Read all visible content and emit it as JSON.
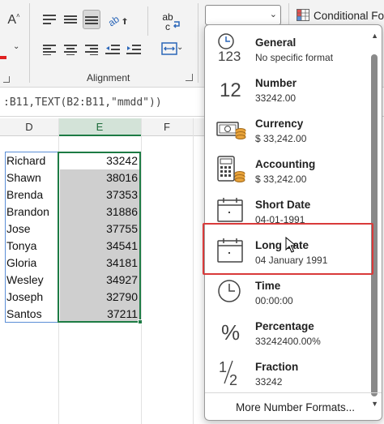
{
  "ribbon": {
    "alignment_group_label": "Alignment",
    "font_size_increase_label": "A",
    "wrap_label": "ab",
    "wrap_label_2": "c",
    "number_format_value": "",
    "conditional_formatting_label": "Conditional For"
  },
  "formula_bar": {
    "text": ":B11,TEXT(B2:B11,\"mmdd\"))"
  },
  "columns": [
    "D",
    "E",
    "F"
  ],
  "rows": [
    {
      "name": "Richard",
      "value": "33242"
    },
    {
      "name": "Shawn",
      "value": "38016"
    },
    {
      "name": "Brenda",
      "value": "37353"
    },
    {
      "name": "Brandon",
      "value": "31886"
    },
    {
      "name": "Jose",
      "value": "37755"
    },
    {
      "name": "Tonya",
      "value": "34541"
    },
    {
      "name": "Gloria",
      "value": "34181"
    },
    {
      "name": "Wesley",
      "value": "34927"
    },
    {
      "name": "Joseph",
      "value": "32790"
    },
    {
      "name": "Santos",
      "value": "37211"
    }
  ],
  "number_formats": {
    "items": [
      {
        "name": "General",
        "sample": "No specific format",
        "icon": "clock-123-icon"
      },
      {
        "name": "Number",
        "sample": "33242.00",
        "icon": "number-12-icon"
      },
      {
        "name": "Currency",
        "sample": "$ 33,242.00",
        "icon": "currency-icon"
      },
      {
        "name": "Accounting",
        "sample": "$ 33,242.00",
        "icon": "calculator-icon"
      },
      {
        "name": "Short Date",
        "sample": "04-01-1991",
        "icon": "calendar-icon"
      },
      {
        "name": "Long Date",
        "sample": "04 January 1991",
        "icon": "calendar-icon"
      },
      {
        "name": "Time",
        "sample": "00:00:00",
        "icon": "clock-icon"
      },
      {
        "name": "Percentage",
        "sample": "33242400.00%",
        "icon": "percent-icon"
      },
      {
        "name": "Fraction",
        "sample": "33242",
        "icon": "fraction-icon"
      }
    ],
    "icon_text": {
      "general": "123",
      "number": "12",
      "percent": "%",
      "fraction_num": "1",
      "fraction_den": "2"
    },
    "more_label": "More Number Formats..."
  },
  "colors": {
    "excel_green": "#1d7b44",
    "highlight_red": "#d93a3a",
    "selection_gray": "#cfcfcf"
  }
}
